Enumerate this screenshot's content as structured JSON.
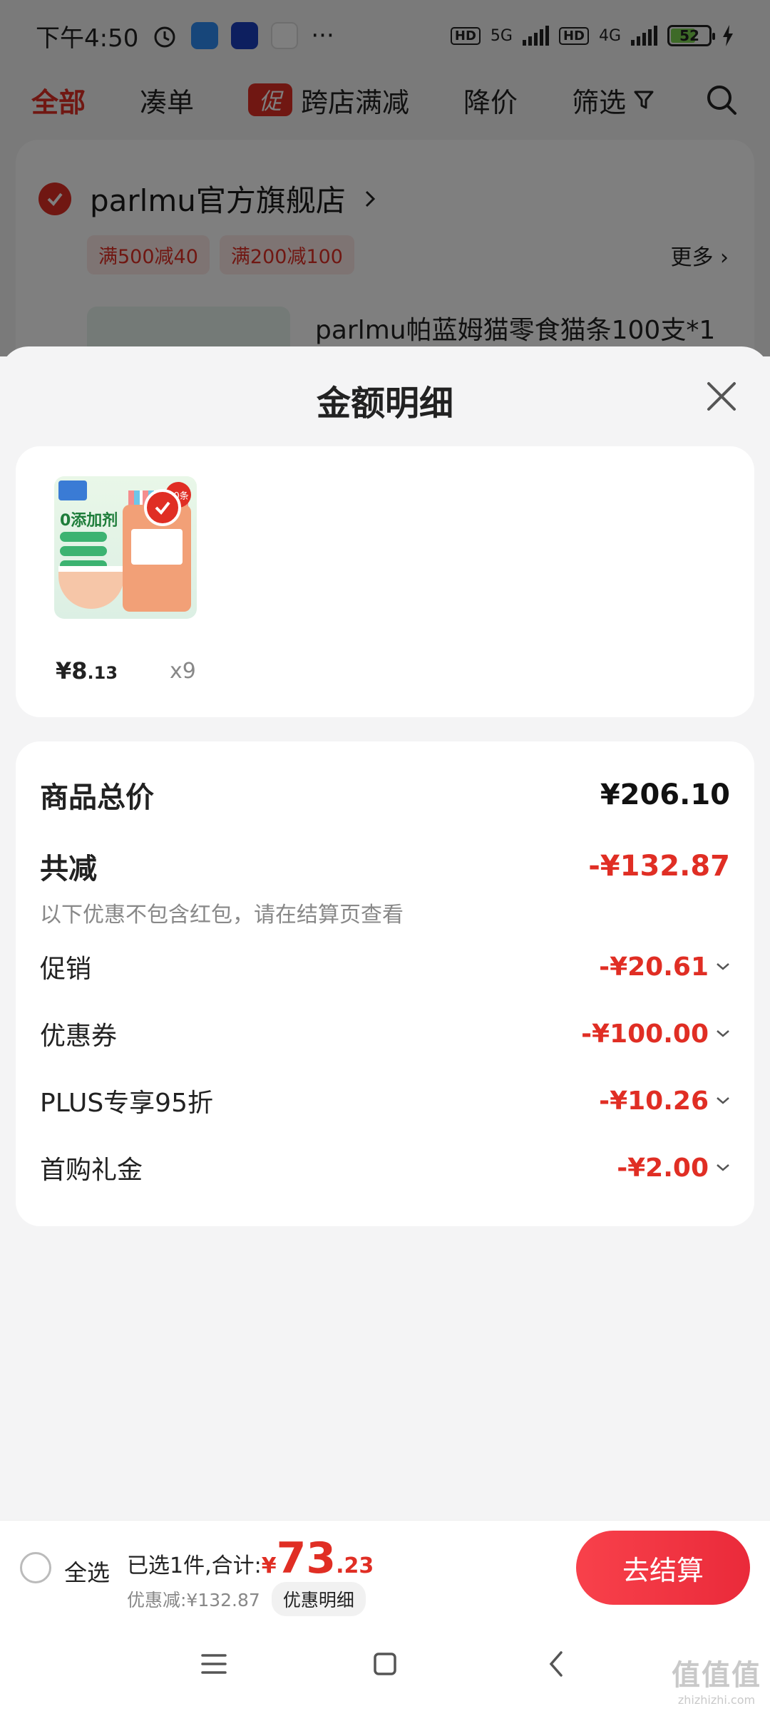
{
  "status_bar": {
    "time": "下午4:50",
    "more": "···",
    "hd1": "HD",
    "net1": "5G",
    "hd2": "HD",
    "net2": "4G",
    "battery": "52"
  },
  "tabs": {
    "all": "全部",
    "bundle": "凑单",
    "promo_badge": "促",
    "cross_store": "跨店满减",
    "price_drop": "降价",
    "filter": "筛选"
  },
  "store": {
    "name": "parlmu官方旗舰店",
    "coupons": [
      "满500减40",
      "满200减100"
    ],
    "more": "更多",
    "product_title": "parlmu帕蓝姆猫零食猫条100支*1"
  },
  "sheet": {
    "title": "金额明细",
    "item": {
      "price_yen": "¥8",
      "price_dec": ".13",
      "qty": "x9",
      "badge": "60条",
      "thumb_text": "0添加剂"
    },
    "summary": {
      "total_label": "商品总价",
      "total_value": "¥206.10",
      "reduce_label": "共减",
      "reduce_value": "-¥132.87",
      "note": "以下优惠不包含红包，请在结算页查看",
      "lines": [
        {
          "label": "促销",
          "value": "-¥20.61"
        },
        {
          "label": "优惠券",
          "value": "-¥100.00"
        },
        {
          "label": "PLUS专享95折",
          "value": "-¥10.26"
        },
        {
          "label": "首购礼金",
          "value": "-¥2.00"
        }
      ]
    }
  },
  "bottom": {
    "select_all": "全选",
    "selected_text": "已选1件,合计:",
    "total_yen": "¥",
    "total_int": "73",
    "total_dec": ".23",
    "discount_text": "优惠减:¥132.87",
    "detail_button": "优惠明细",
    "checkout": "去结算"
  },
  "watermark": {
    "big": "值值值",
    "small": "zhizhizhi.com"
  },
  "colors": {
    "accent": "#e02e24",
    "background": "#f4f4f5",
    "card": "#ffffff"
  }
}
